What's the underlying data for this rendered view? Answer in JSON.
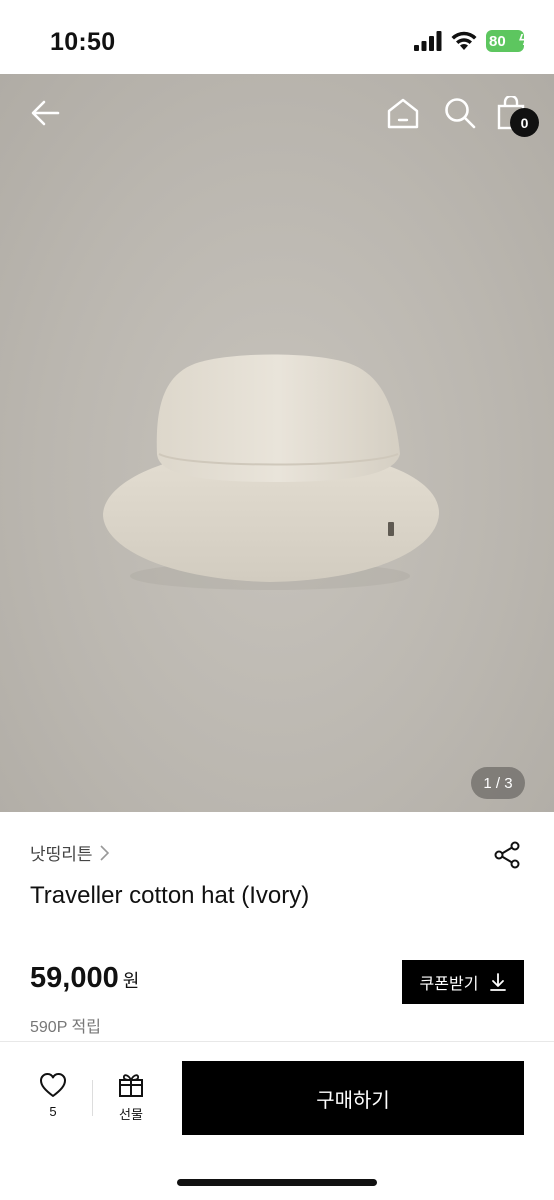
{
  "status_bar": {
    "time": "10:50",
    "battery_level": "80"
  },
  "header": {
    "cart_count": "0"
  },
  "gallery": {
    "indicator": "1 / 3"
  },
  "product": {
    "brand": "낫띵리튼",
    "title": "Traveller cotton hat (Ivory)",
    "price": "59,000",
    "price_unit": "원",
    "points": "590P 적립",
    "coupon_label": "쿠폰받기"
  },
  "bottom_bar": {
    "like_count": "5",
    "gift_label": "선물",
    "buy_label": "구매하기"
  },
  "colors": {
    "accent": "#000000",
    "battery": "#5dc65f",
    "hero_bg": "#bab6af"
  }
}
